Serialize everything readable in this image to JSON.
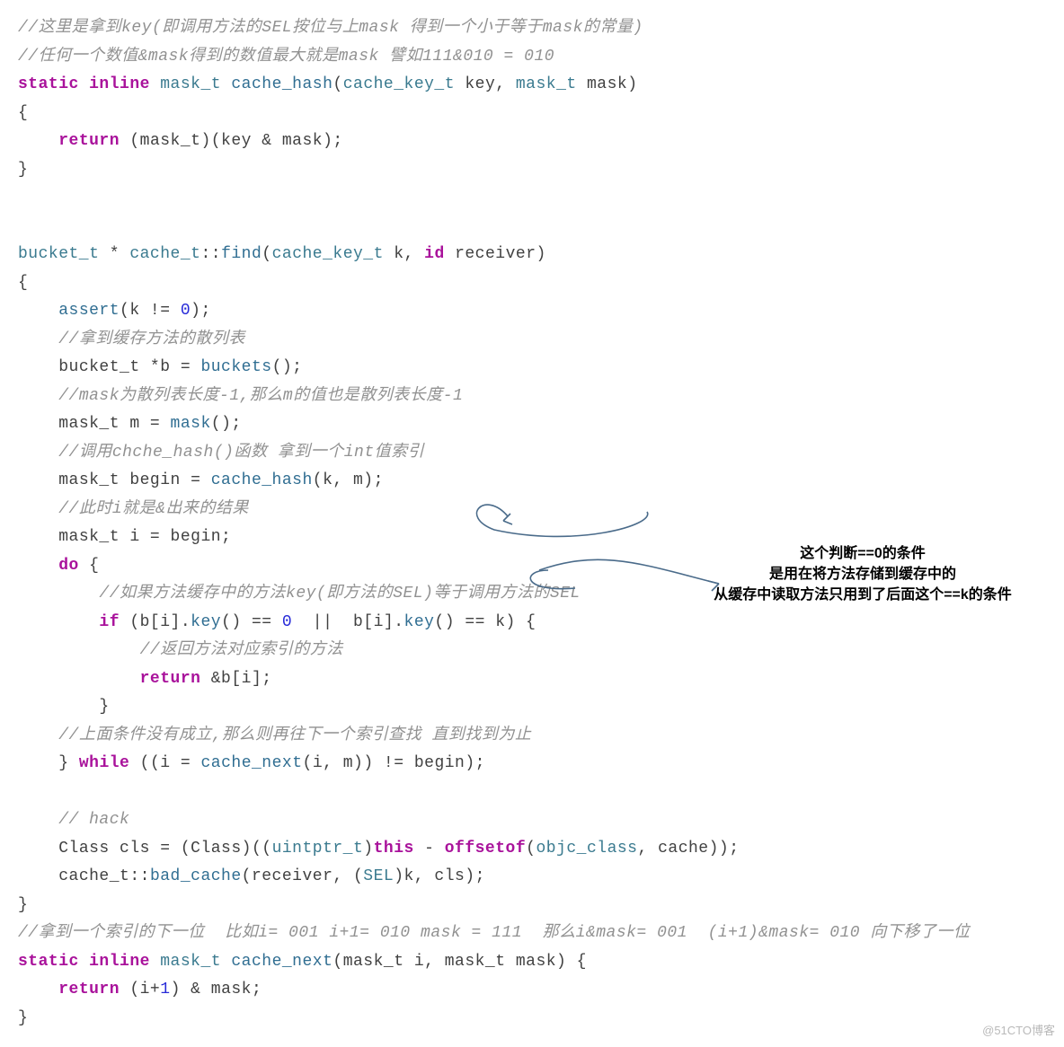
{
  "code": {
    "c01": "//这里是拿到key(即调用方法的SEL按位与上mask 得到一个小于等于mask的常量)",
    "c02": "//任何一个数值&mask得到的数值最大就是mask 譬如111&010 = 010",
    "kw_static": "static",
    "kw_inline": "inline",
    "ty_mask_t": "mask_t",
    "fn_cache_hash": "cache_hash",
    "ty_cache_key_t": "cache_key_t",
    "id_key": "key",
    "id_mask": "mask",
    "brace_open": "{",
    "brace_close": "}",
    "kw_return": "return",
    "l05": "(mask_t)(key & mask);",
    "ty_bucket_t": "bucket_t",
    "star": " * ",
    "ty_cache_t": "cache_t",
    "scope": "::",
    "fn_find": "find",
    "id_k": "k",
    "kw_id": "id",
    "id_receiver": "receiver",
    "l11_a": "assert",
    "l11_b": "(k != ",
    "num0": "0",
    "l11_c": ");",
    "c12": "//拿到缓存方法的散列表",
    "l13_a": "bucket_t *b = ",
    "l13_b": "buckets",
    "l13_c": "();",
    "c14": "//mask为散列表长度-1,那么m的值也是散列表长度-1",
    "l15_a": "mask_t m = ",
    "l15_b": "mask",
    "l15_c": "();",
    "c16": "//调用chche_hash()函数 拿到一个int值索引",
    "l17_a": "mask_t begin = ",
    "l17_b": "cache_hash",
    "l17_c": "(k, m);",
    "c18": "//此时i就是&出来的结果",
    "l19": "mask_t i = begin;",
    "kw_do": "do",
    "c21": "//如果方法缓存中的方法key(即方法的SEL)等于调用方法的SEL",
    "kw_if": "if",
    "l22_a": " (b[i].",
    "l22_key": "key",
    "l22_b": "() == ",
    "l22_c": "  ||  b[i].",
    "l22_d": "() == k) {",
    "c23": "//返回方法对应索引的方法",
    "l24": " &b[i];",
    "c26": "//上面条件没有成立,那么则再往下一个索引查找 直到找到为止",
    "kw_while": "while",
    "l27_a": " ((i = ",
    "l27_b": "cache_next",
    "l27_c": "(i, m)) != begin);",
    "c29": "// hack",
    "l30_a": "Class cls = (Class)((",
    "ty_uintptr": "uintptr_t",
    "l30_b": ")",
    "kw_this": "this",
    "l30_c": " - ",
    "fn_offsetof": "offsetof",
    "l30_d": "(",
    "ty_objc_class": "objc_class",
    "l30_e": ", cache));",
    "l31_a": "cache_t::",
    "l31_b": "bad_cache",
    "l31_c": "(receiver, (",
    "ty_SEL": "SEL",
    "l31_d": ")k, cls);",
    "c33": "//拿到一个索引的下一位  比如i= 001 i+1= 010 mask = 111  那么i&mask= 001  (i+1)&mask= 010 向下移了一位",
    "fn_cache_next": "cache_next",
    "l34_params": "(mask_t i, mask_t mask) {",
    "l35_a": " (i+",
    "num1": "1",
    "l35_b": ") & mask;"
  },
  "annotation": {
    "line1": "这个判断==0的条件",
    "line2": "是用在将方法存储到缓存中的",
    "line3": "从缓存中读取方法只用到了后面这个==k的条件"
  },
  "watermark": "@51CTO博客"
}
